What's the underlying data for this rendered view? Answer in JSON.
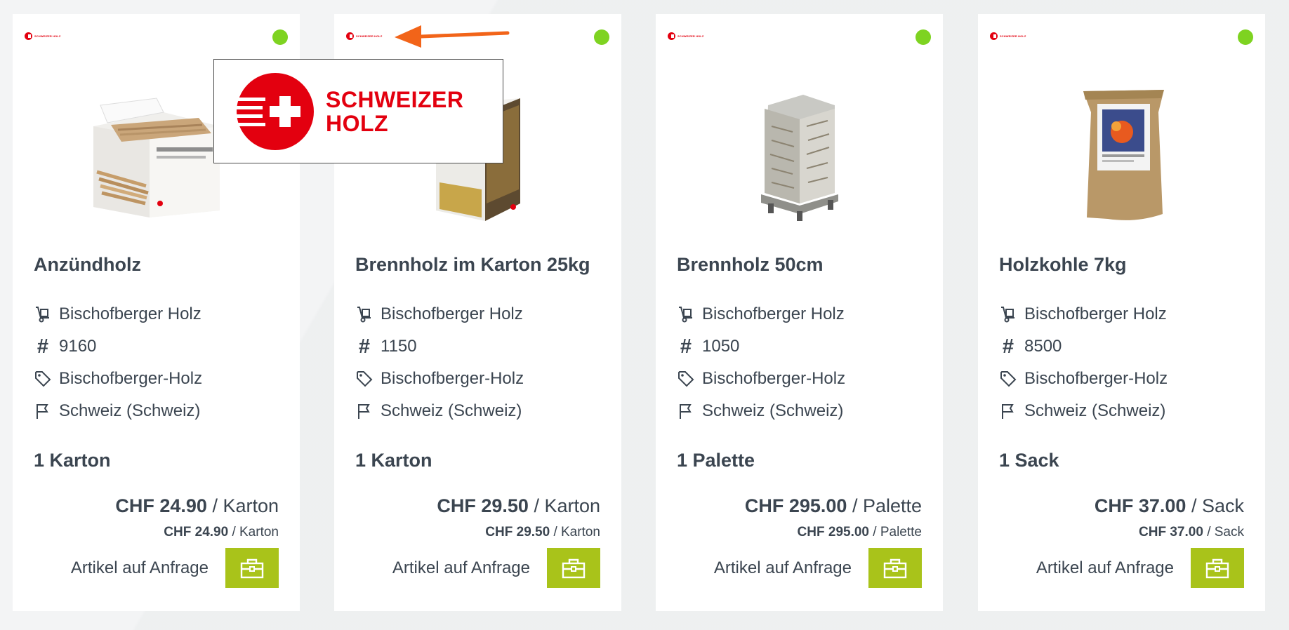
{
  "callout": {
    "brand_line1": "SCHWEIZER",
    "brand_line2": "HOLZ",
    "brand_small": "SCHWEIZER HOLZ",
    "arrow_color": "#f26419",
    "brand_color": "#e3000f"
  },
  "colors": {
    "status_dot": "#7ed321",
    "cart_button": "#a9c31a",
    "text": "#3b4550"
  },
  "products": [
    {
      "title": "Anzündholz",
      "supplier": "Bischofberger Holz",
      "article_no": "9160",
      "tag": "Bischofberger-Holz",
      "origin": "Schweiz (Schweiz)",
      "unit": "1 Karton",
      "price": "CHF 24.90",
      "price_unit": "/ Karton",
      "price_sub": "CHF 24.90",
      "price_sub_unit": "/ Karton",
      "request_label": "Artikel auf Anfrage",
      "image": "kindling-box"
    },
    {
      "title": "Brennholz im Karton 25kg",
      "supplier": "Bischofberger Holz",
      "article_no": "1150",
      "tag": "Bischofberger-Holz",
      "origin": "Schweiz (Schweiz)",
      "unit": "1 Karton",
      "price": "CHF 29.50",
      "price_unit": "/ Karton",
      "price_sub": "CHF 29.50",
      "price_sub_unit": "/ Karton",
      "request_label": "Artikel auf Anfrage",
      "image": "firewood-box"
    },
    {
      "title": "Brennholz 50cm",
      "supplier": "Bischofberger Holz",
      "article_no": "1050",
      "tag": "Bischofberger-Holz",
      "origin": "Schweiz (Schweiz)",
      "unit": "1 Palette",
      "price": "CHF 295.00",
      "price_unit": "/ Palette",
      "price_sub": "CHF 295.00",
      "price_sub_unit": "/ Palette",
      "request_label": "Artikel auf Anfrage",
      "image": "firewood-pallet"
    },
    {
      "title": "Holzkohle 7kg",
      "supplier": "Bischofberger Holz",
      "article_no": "8500",
      "tag": "Bischofberger-Holz",
      "origin": "Schweiz (Schweiz)",
      "unit": "1 Sack",
      "price": "CHF 37.00",
      "price_unit": "/ Sack",
      "price_sub": "CHF 37.00",
      "price_sub_unit": "/ Sack",
      "request_label": "Artikel auf Anfrage",
      "image": "charcoal-sack"
    }
  ]
}
